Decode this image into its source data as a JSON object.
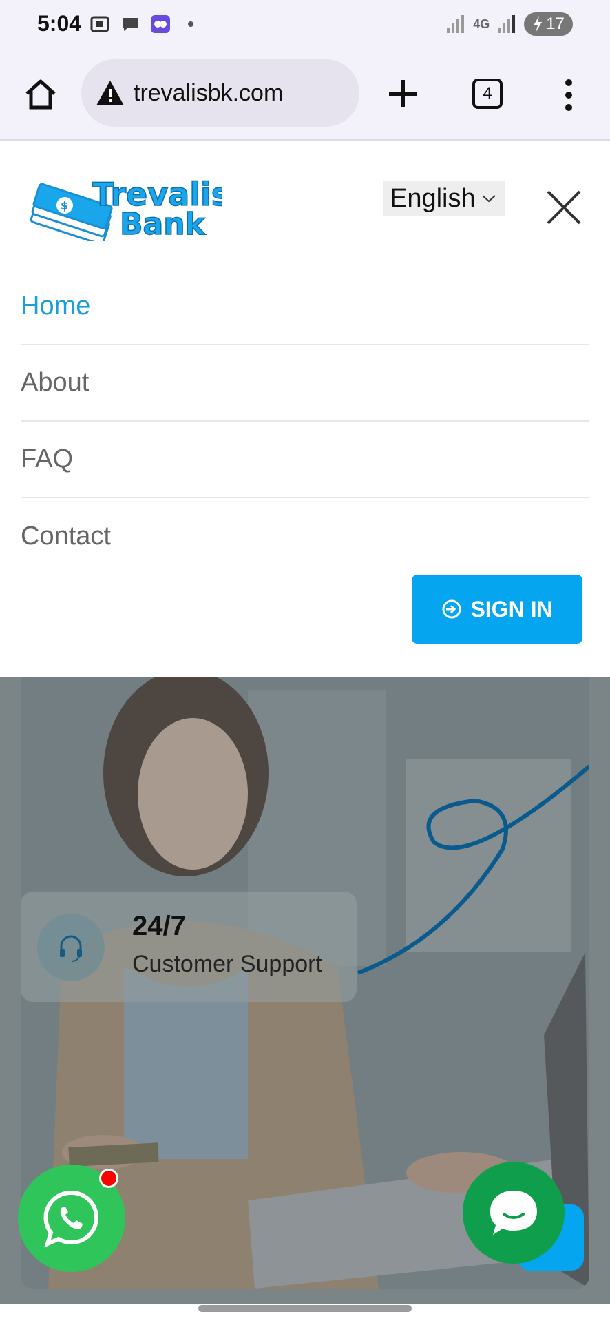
{
  "status_bar": {
    "time": "5:04",
    "network": "4G",
    "battery": "17"
  },
  "browser": {
    "url": "trevalisbk.com",
    "tab_count": "4"
  },
  "header": {
    "logo_line1": "Trevalis",
    "logo_line2": "Bank",
    "language": "English"
  },
  "nav": {
    "items": [
      {
        "label": "Home",
        "active": true
      },
      {
        "label": "About",
        "active": false
      },
      {
        "label": "FAQ",
        "active": false
      },
      {
        "label": "Contact",
        "active": false
      }
    ],
    "signin_label": "SIGN IN"
  },
  "hero": {
    "support_title": "24/7",
    "support_subtitle": "Customer Support"
  },
  "colors": {
    "accent": "#06a5f0",
    "active_link": "#1aa0d8",
    "whatsapp": "#2fc55a",
    "chat": "#0e9e4c"
  }
}
